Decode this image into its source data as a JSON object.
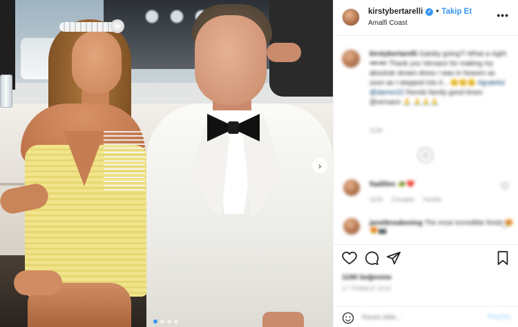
{
  "post": {
    "carousel_total": 4,
    "carousel_active": 1,
    "next_glyph": "›"
  },
  "header": {
    "username": "kirstybertarelli",
    "separator": "•",
    "follow_label": "Takip Et",
    "location": "Amalfi Coast",
    "more_glyph": "•••"
  },
  "caption": {
    "username": "kirstybertarelli",
    "text": "Gatsby going?! What a night 🕶🕶 Thank you Versace for making my absolute dream dress I was in heaven as soon as I stepped into it...",
    "emoji_line": "😊😊😊",
    "tags": "#grateful @darren22",
    "tail": "friends family good times @versace 🙏",
    "emoji_tail": "🙏🙏🙏",
    "time": "113h"
  },
  "comments": [
    {
      "username": "fiadillen",
      "text": "🐢❤️",
      "time": "113h",
      "reply": "Cevapla",
      "translate": "Yanıtla"
    },
    {
      "username": "janetbreakening",
      "text": "The most incredible finish 😍😍📷",
      "time": "",
      "reply": "",
      "translate": ""
    }
  ],
  "actions": {
    "like_icon": "heart-outline",
    "comment_icon": "speech-bubble",
    "share_icon": "paper-plane",
    "save_icon": "bookmark"
  },
  "likes": "1190 beğenme",
  "date": "17 TEMMUZ 2019",
  "add_comment": {
    "placeholder": "Yorum ekle...",
    "post_label": "Paylaş"
  },
  "colors": {
    "accent": "#3897f0",
    "muted": "#8e8e8e",
    "text": "#262626",
    "border": "#efefef"
  }
}
